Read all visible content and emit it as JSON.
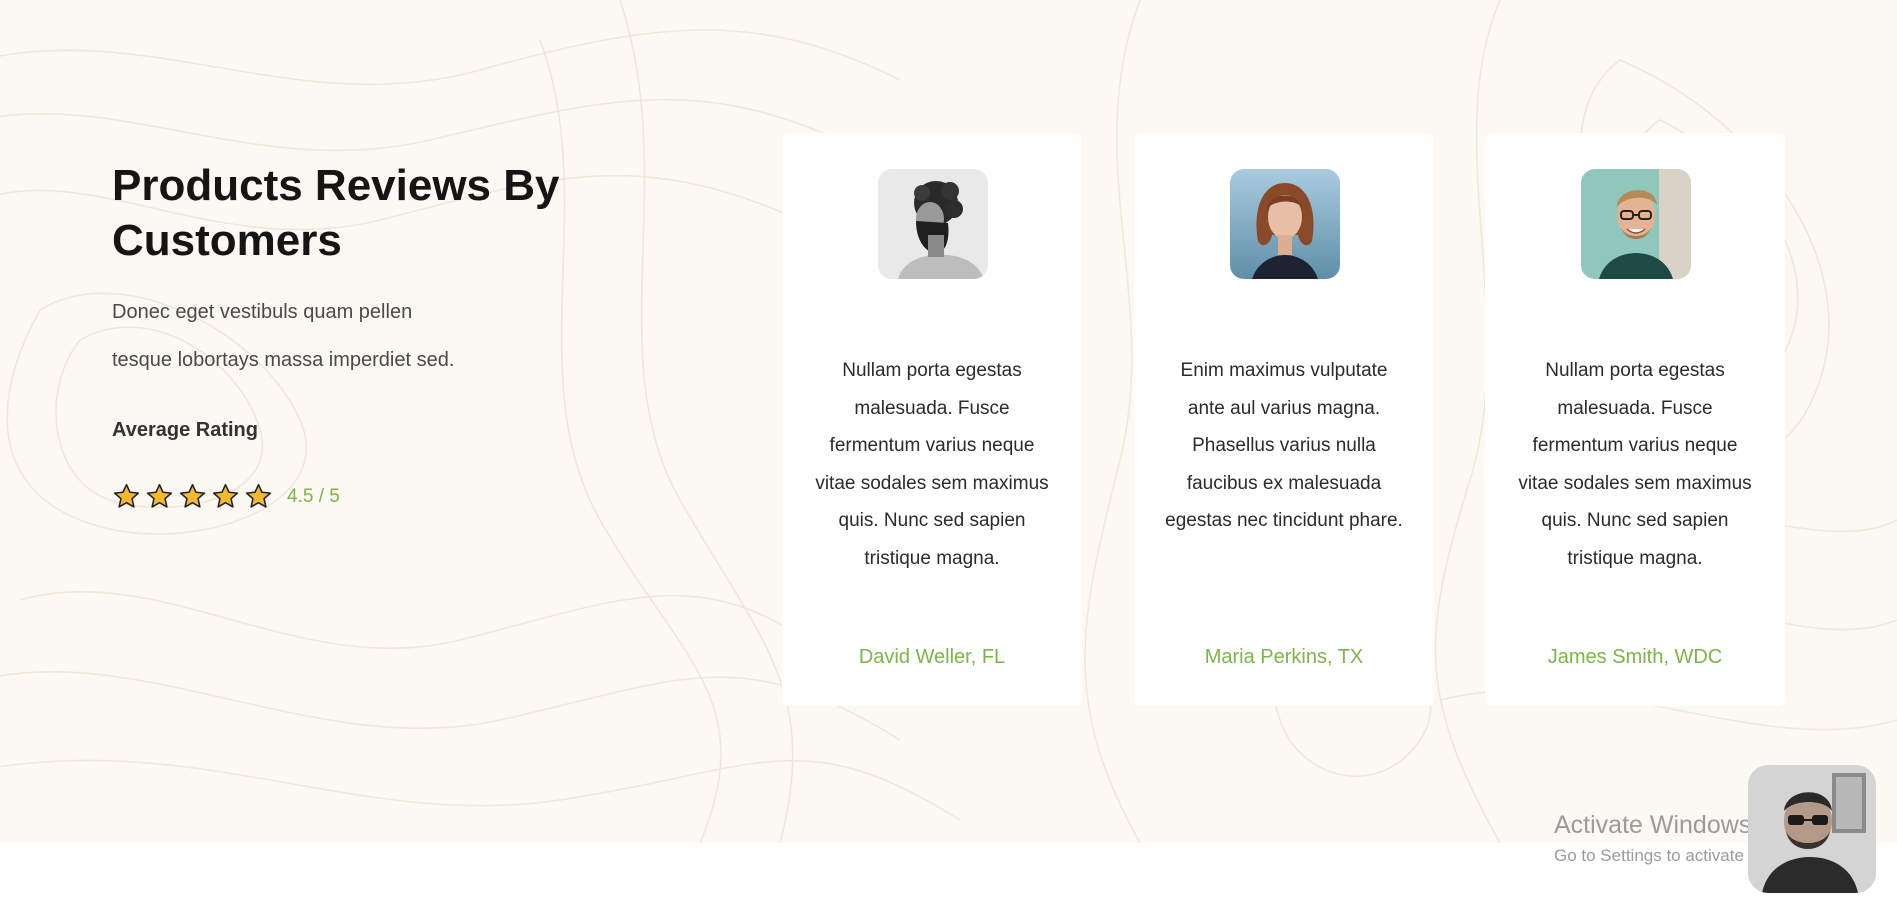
{
  "heading": "Products Reviews By Customers",
  "description_lines": [
    "Donec eget vestibuls quam pellen",
    "tesque lobortays massa imperdiet sed."
  ],
  "average_rating": {
    "label": "Average Rating",
    "value": 4.5,
    "max": 5,
    "display": "4.5 / 5",
    "star_color": "#f5b82e"
  },
  "reviews": [
    {
      "avatar": "portrait-bearded-man-grayscale",
      "quote": "Nullam porta egestas malesuada. Fusce fermentum varius neque vitae sodales sem maximus quis. Nunc sed sapien tristique magna.",
      "author": "David Weller, FL"
    },
    {
      "avatar": "portrait-woman-red-hair",
      "quote": "Enim maximus vulputate ante aul varius magna. Phasellus varius nulla faucibus ex malesuada egestas nec tincidunt phare.",
      "author": "Maria Perkins, TX"
    },
    {
      "avatar": "portrait-smiling-man-glasses",
      "quote": "Nullam porta egestas malesuada. Fusce fermentum varius neque vitae sodales sem maximus quis. Nunc sed sapien tristique magna.",
      "author": "James Smith, WDC"
    }
  ],
  "os_overlay": {
    "activate_title": "Activate Windows",
    "activate_sub": "Go to Settings to activate Windows."
  },
  "colors": {
    "accent_green": "#7ab648",
    "section_bg": "#fcf8f3",
    "card_bg": "#ffffff"
  }
}
